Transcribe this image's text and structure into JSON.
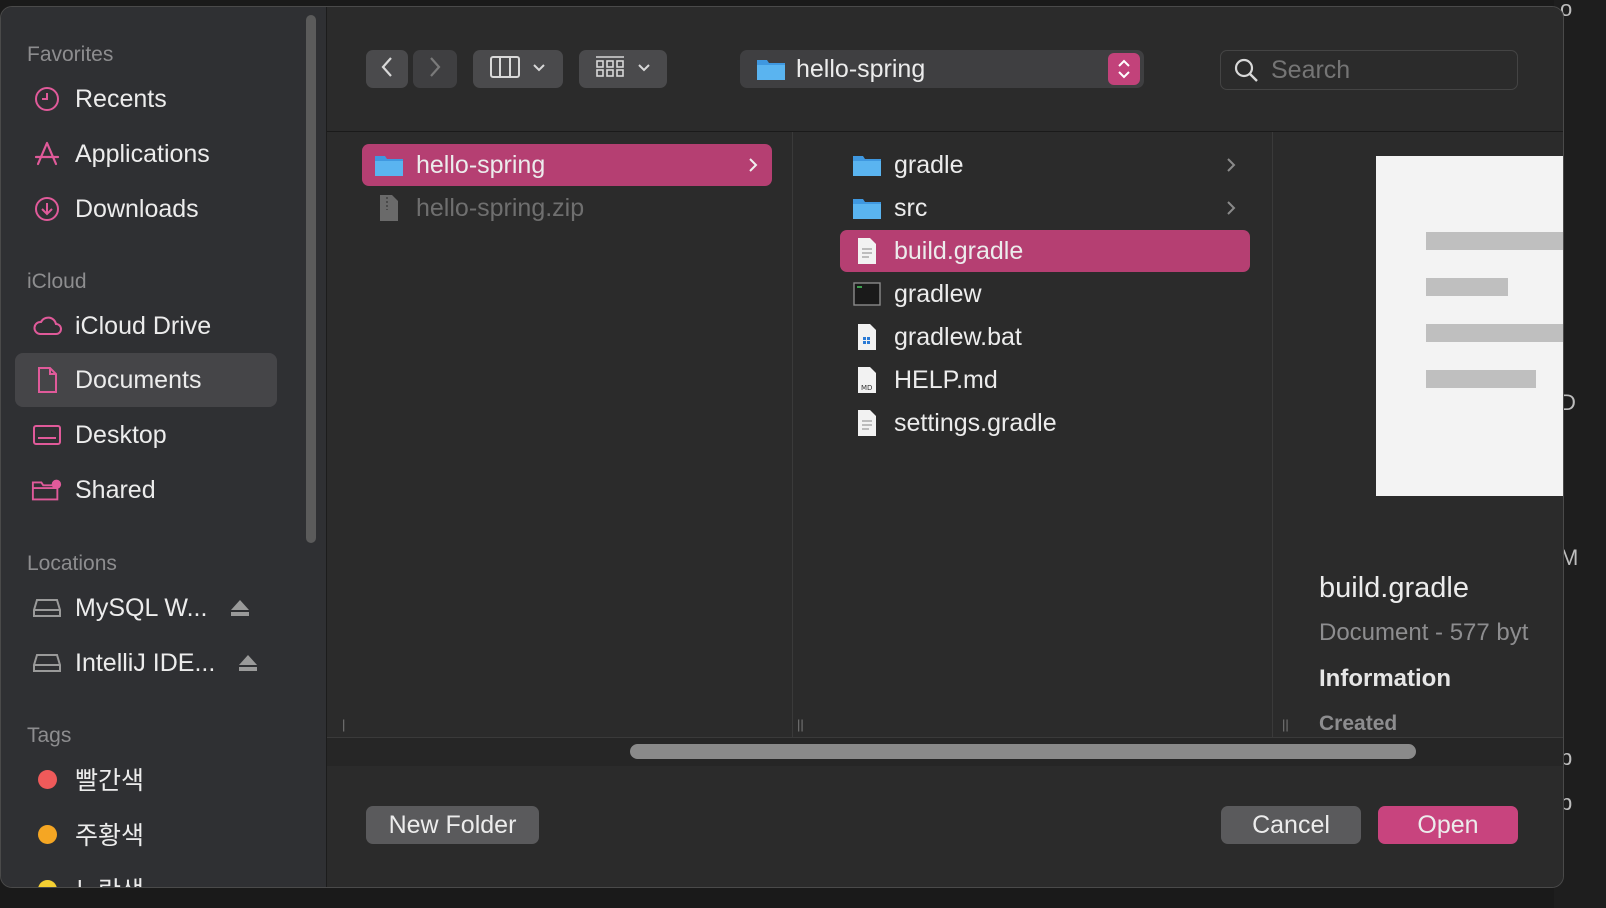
{
  "sidebar": {
    "favorites_title": "Favorites",
    "favorites": [
      {
        "label": "Recents",
        "icon": "clock-icon"
      },
      {
        "label": "Applications",
        "icon": "applications-icon"
      },
      {
        "label": "Downloads",
        "icon": "download-icon"
      }
    ],
    "icloud_title": "iCloud",
    "icloud": [
      {
        "label": "iCloud Drive",
        "icon": "cloud-icon"
      },
      {
        "label": "Documents",
        "icon": "document-icon",
        "selected": true
      },
      {
        "label": "Desktop",
        "icon": "desktop-icon"
      },
      {
        "label": "Shared",
        "icon": "shared-folder-icon"
      }
    ],
    "locations_title": "Locations",
    "locations": [
      {
        "label": "MySQL W...",
        "icon": "drive-icon"
      },
      {
        "label": "IntelliJ IDE...",
        "icon": "drive-icon"
      }
    ],
    "tags_title": "Tags",
    "tags": [
      {
        "label": "빨간색",
        "color": "#ef5a5a"
      },
      {
        "label": "주황색",
        "color": "#f5a623"
      },
      {
        "label": "노란색",
        "color": "#f5d033"
      }
    ]
  },
  "toolbar": {
    "current_folder": "hello-spring",
    "search_placeholder": "Search"
  },
  "columns": {
    "col1": [
      {
        "label": "hello-spring",
        "type": "folder",
        "selected": true
      },
      {
        "label": "hello-spring.zip",
        "type": "zip",
        "dim": true
      }
    ],
    "col2": [
      {
        "label": "gradle",
        "type": "folder"
      },
      {
        "label": "src",
        "type": "folder"
      },
      {
        "label": "build.gradle",
        "type": "doc",
        "selected": true
      },
      {
        "label": "gradlew",
        "type": "exec"
      },
      {
        "label": "gradlew.bat",
        "type": "bat"
      },
      {
        "label": "HELP.md",
        "type": "md"
      },
      {
        "label": "settings.gradle",
        "type": "doc"
      }
    ]
  },
  "preview": {
    "name": "build.gradle",
    "kind": "Document - 577 byt",
    "info_title": "Information",
    "created_label": "Created"
  },
  "buttons": {
    "new_folder": "New Folder",
    "cancel": "Cancel",
    "open": "Open"
  },
  "colors": {
    "accent": "#c8447e",
    "selection": "#b53f72",
    "folder": "#4aa3e8"
  }
}
